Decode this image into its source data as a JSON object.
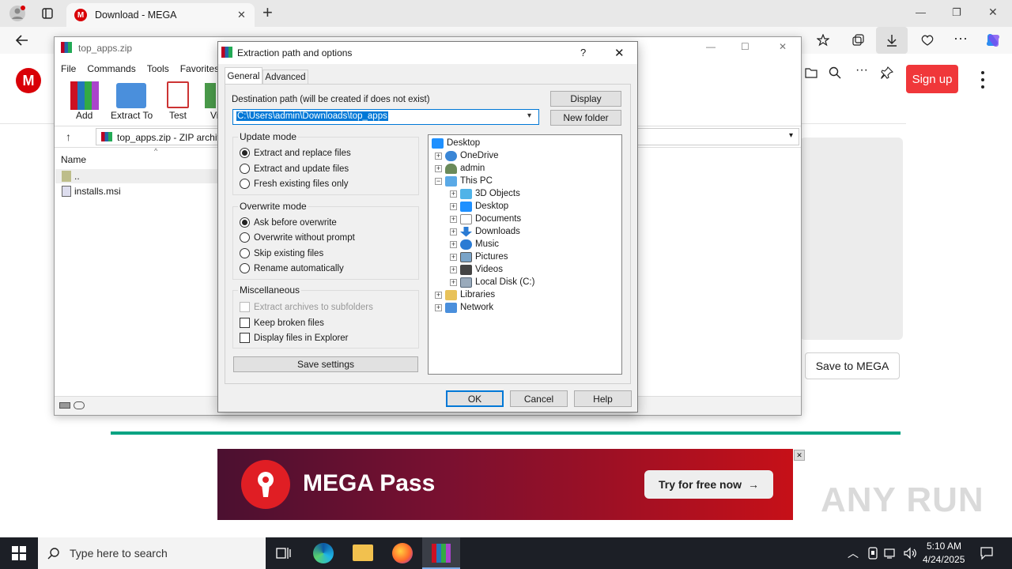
{
  "browser": {
    "tab_title": "Download - MEGA",
    "new_tab": "+",
    "win_min": "—",
    "win_max": "❐",
    "win_close": "✕"
  },
  "mega": {
    "logo": "M",
    "signup": "Sign up",
    "save_to_mega": "Save to MEGA",
    "ad_title": "MEGA Pass",
    "ad_button": "Try for free now",
    "ad_close": "✕",
    "progress": 1.0
  },
  "winrar": {
    "title": "top_apps.zip",
    "menu": [
      "File",
      "Commands",
      "Tools",
      "Favorites"
    ],
    "toolbar": [
      "Add",
      "Extract To",
      "Test",
      "Vi"
    ],
    "path": "top_apps.zip - ZIP archiv",
    "col_name": "Name",
    "files": [
      "..",
      "installs.msi"
    ]
  },
  "dialog": {
    "title": "Extraction path and options",
    "help_q": "?",
    "close": "✕",
    "tabs": [
      "General",
      "Advanced"
    ],
    "dest_label": "Destination path (will be created if does not exist)",
    "dest_value": "C:\\Users\\admin\\Downloads\\top_apps",
    "display_btn": "Display",
    "new_folder_btn": "New folder",
    "update_mode": {
      "label": "Update mode",
      "options": [
        "Extract and replace files",
        "Extract and update files",
        "Fresh existing files only"
      ],
      "selected": 0
    },
    "overwrite_mode": {
      "label": "Overwrite mode",
      "options": [
        "Ask before overwrite",
        "Overwrite without prompt",
        "Skip existing files",
        "Rename automatically"
      ],
      "selected": 0
    },
    "misc": {
      "label": "Miscellaneous",
      "options": [
        "Extract archives to subfolders",
        "Keep broken files",
        "Display files in Explorer"
      ]
    },
    "save_settings": "Save settings",
    "tree": [
      "Desktop",
      "OneDrive",
      "admin",
      "This PC",
      "3D Objects",
      "Desktop",
      "Documents",
      "Downloads",
      "Music",
      "Pictures",
      "Videos",
      "Local Disk (C:)",
      "Libraries",
      "Network"
    ],
    "ok": "OK",
    "cancel": "Cancel",
    "help": "Help"
  },
  "taskbar": {
    "search_placeholder": "Type here to search",
    "time": "5:10 AM",
    "date": "4/24/2025"
  },
  "watermark": "ANY RUN",
  "colors": {
    "mega_red": "#d90007",
    "signup_red": "#f0373a",
    "progress_green": "#00a382",
    "taskbar": "#1c1f26"
  }
}
